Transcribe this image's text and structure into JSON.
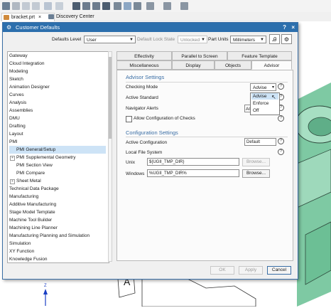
{
  "toolbar": {
    "icons": [
      "undo-icon",
      "redo-icon",
      "snap-icon",
      "view-icon",
      "render-icon",
      "layer-icon",
      "selection-icon",
      "display-icon",
      "analysis-icon",
      "settings-icon"
    ]
  },
  "tabs": {
    "doc_tab": "bracket.prt",
    "close_glyph": "×",
    "discovery_tab": "Discovery Center"
  },
  "dialog": {
    "title": "Customer Defaults",
    "help": "?",
    "close": "×",
    "defaults_level_label": "Defaults Level",
    "defaults_level_value": "User",
    "lock_state_label": "Default Lock State",
    "lock_state_value": "Unlocked",
    "part_units_label": "Part Units",
    "part_units_value": "Millimeters"
  },
  "tree": {
    "items": [
      "Gateway",
      "Cloud Integration",
      "Modeling",
      "Sketch",
      "Animation Designer",
      "Curves",
      "Analysis",
      "Assemblies",
      "DMU",
      "Drafting",
      "Layout",
      "PMI",
      "PMI General/Setup",
      "PMI Supplemental Geometry",
      "PMI Section View",
      "PMI Compare",
      "Sheet Metal",
      "Technical Data Package",
      "Manufacturing",
      "Additive Manufacturing",
      "Stage Model Template",
      "Machine Tool Builder",
      "Machining Line Planner",
      "Manufacturing Planning and Simulation",
      "Simulation",
      "XY Function",
      "Knowledge Fusion"
    ]
  },
  "tabs_row1": [
    "Effectivity",
    "Parallel to Screen",
    "Feature Template"
  ],
  "tabs_row2": [
    "Miscellaneous",
    "Display",
    "Objects",
    "Advisor"
  ],
  "advisor": {
    "section_title": "Advisor Settings",
    "checking_mode_label": "Checking Mode",
    "checking_mode_value": "Advise",
    "active_standard_label": "Active Standard",
    "navigator_alerts_label": "Navigator Alerts",
    "navigator_alerts_value": "All",
    "allow_config_label": "Allow Configuration of Checks",
    "dropdown_options": [
      "Advise",
      "Enforce",
      "Off"
    ]
  },
  "configuration": {
    "section_title": "Configuration Settings",
    "active_config_label": "Active Configuration",
    "active_config_value": "Default",
    "local_fs_label": "Local File System",
    "unix_label": "Unix",
    "unix_value": "${UGII_TMP_DIR}",
    "windows_label": "Windows",
    "windows_value": "%UGII_TMP_DIR%",
    "browse_label": "Browse..."
  },
  "footer": {
    "ok": "OK",
    "apply": "Apply",
    "cancel": "Cancel"
  },
  "viewport": {
    "axis_label": "Z",
    "note_label": "A"
  },
  "colors": {
    "title_bar": "#2c6fad",
    "model_green": "#8fd4b0",
    "accent_blue": "#3a6ea5"
  }
}
